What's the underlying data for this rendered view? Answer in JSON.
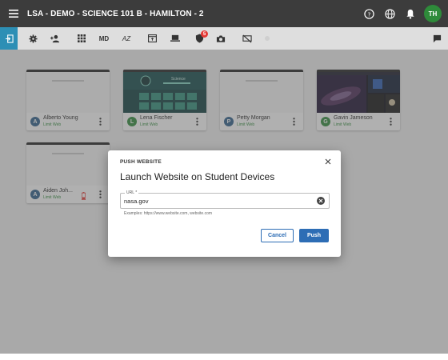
{
  "header": {
    "title": "LSA - DEMO - SCIENCE 101 B - HAMILTON - 2",
    "user_initials": "TH",
    "icons": [
      "help-icon",
      "globe-icon",
      "bell-icon"
    ]
  },
  "toolbar": {
    "md_label": "MD",
    "az_label": "AZ",
    "shield_badge": "5"
  },
  "students": [
    {
      "initial": "A",
      "name": "Alberto Young",
      "status": "Limit Web",
      "color": "#2d5f8a"
    },
    {
      "initial": "L",
      "name": "Lena Fischer",
      "status": "Limit Web",
      "color": "#2e8b3a"
    },
    {
      "initial": "P",
      "name": "Petty Morgan",
      "status": "Limit Web",
      "color": "#2d5f8a"
    },
    {
      "initial": "G",
      "name": "Gavin Jameson",
      "status": "Limit Web",
      "color": "#2e8b3a"
    },
    {
      "initial": "A",
      "name": "Aiden Joh...",
      "status": "Limit Web",
      "color": "#2d5f8a"
    }
  ],
  "thumbnail_texts": {
    "lena_science": "Science"
  },
  "modal": {
    "header": "PUSH WEBSITE",
    "title": "Launch Website on Student Devices",
    "url_label": "URL *",
    "url_value": "nasa.gov",
    "hint": "Examples: https://www.website.com, website.com",
    "cancel_label": "Cancel",
    "push_label": "Push"
  }
}
